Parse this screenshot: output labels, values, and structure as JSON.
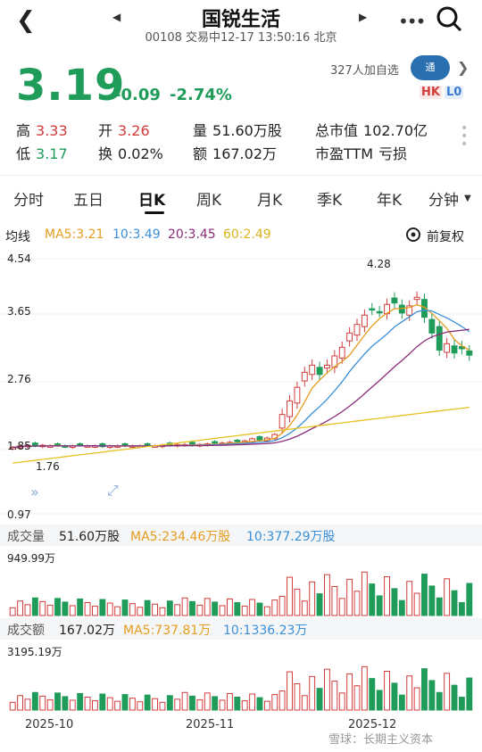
{
  "header": {
    "title": "国锐生活",
    "subtitle": "00108 交易中12-17 13:50:16 北京"
  },
  "quote": {
    "price": "3.19",
    "change": "-0.09",
    "change_pct": "-2.74%",
    "watchers": "327人加自选",
    "tags": [
      "HK",
      "L0"
    ]
  },
  "stats": {
    "high_label": "高",
    "high": "3.33",
    "open_label": "开",
    "open": "3.26",
    "volume_label": "量",
    "volume": "51.60万股",
    "mktcap_label": "总市值",
    "mktcap": "102.70亿",
    "low_label": "低",
    "low": "3.17",
    "turnover_label": "换",
    "turnover": "0.02%",
    "amount_label": "额",
    "amount": "167.02万",
    "pe_label": "市盈TTM",
    "pe": "亏损"
  },
  "tabs": [
    "分时",
    "五日",
    "日K",
    "周K",
    "月K",
    "季K",
    "年K",
    "分钟"
  ],
  "active_tab": "日K",
  "ma": {
    "label": "均线",
    "ma5": "MA5:3.21",
    "ma10": "10:3.49",
    "ma20": "20:3.45",
    "ma60": "60:2.49",
    "adjust": "前复权"
  },
  "price_axis": {
    "top": "4.54",
    "mid1": "3.65",
    "mid2": "2.76",
    "low_mark": "1.85",
    "bottom": "0.97",
    "max_label": "4.28",
    "min_label": "1.76"
  },
  "volume_panel": {
    "label": "成交量",
    "value": "51.60万股",
    "ma5": "MA5:234.46万股",
    "ma10": "10:377.29万股",
    "max": "949.99万"
  },
  "amount_panel": {
    "label": "成交额",
    "value": "167.02万",
    "ma5": "MA5:737.81万",
    "ma10": "10:1336.23万",
    "max": "3195.19万"
  },
  "dates": [
    "2025-10",
    "2025-11",
    "2025-12"
  ],
  "watermark": "雪球：长期主义资本",
  "colors": {
    "up": "#d23c3c",
    "down": "#1f9b5a",
    "ma5": "#e59c1f",
    "ma10": "#3a8fd9",
    "ma20": "#8b2c7a",
    "ma60": "#e5c21f"
  },
  "chart_data": {
    "type": "candlestick",
    "close_prices": [
      1.9,
      1.92,
      1.93,
      1.92,
      1.93,
      1.92,
      1.93,
      1.91,
      1.92,
      1.93,
      1.92,
      1.92,
      1.91,
      1.92,
      1.92,
      1.92,
      1.92,
      1.92,
      1.93,
      1.92,
      1.93,
      1.93,
      1.94,
      1.94,
      1.93,
      1.94,
      1.95,
      1.96,
      1.96,
      1.97,
      1.98,
      1.99,
      2.02,
      2.0,
      2.03,
      2.08,
      2.36,
      2.55,
      2.74,
      2.95,
      3.05,
      2.92,
      3.05,
      3.18,
      3.3,
      3.5,
      3.62,
      3.75,
      3.83,
      3.8,
      3.9,
      3.92,
      3.78,
      3.88,
      4.0,
      3.72,
      3.5,
      3.26,
      3.35,
      3.22,
      3.28,
      3.19
    ],
    "volume_max_wan": 949.99,
    "amount_max_wan": 3195.19
  }
}
